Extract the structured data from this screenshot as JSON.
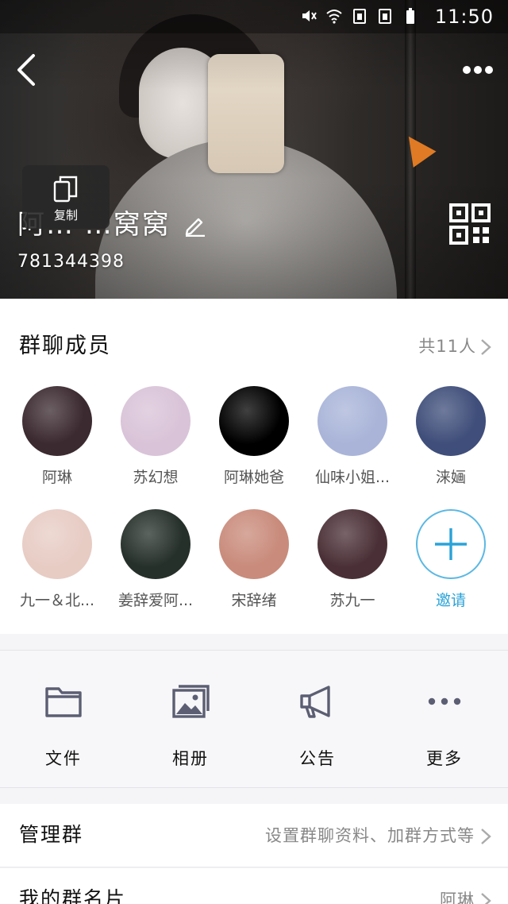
{
  "status_bar": {
    "time": "11:50",
    "icons": [
      "mute-icon",
      "wifi-icon",
      "sim1-icon",
      "sim2-icon",
      "battery-icon"
    ]
  },
  "header": {
    "group_name": "阿… …窝窝",
    "group_id": "781344398",
    "copy_tooltip": "复制"
  },
  "members": {
    "title": "群聊成员",
    "count": "共11人",
    "list": [
      {
        "name": "阿琳",
        "color": "#3b2a30"
      },
      {
        "name": "苏幻想",
        "color": "#d9c3d8"
      },
      {
        "name": "阿琳她爸",
        "color": "#000000"
      },
      {
        "name": "仙味小姐...",
        "color": "#a9b4d8"
      },
      {
        "name": "涞婳",
        "color": "#3f4e7a"
      },
      {
        "name": "九一＆北...",
        "color": "#e7ccc4"
      },
      {
        "name": "姜辞爱阿...",
        "color": "#26302a"
      },
      {
        "name": "宋辞绪",
        "color": "#c98b7b"
      },
      {
        "name": "苏九一",
        "color": "#4a3036"
      }
    ],
    "invite_label": "邀请"
  },
  "functions": [
    {
      "label": "文件",
      "icon": "folder-icon"
    },
    {
      "label": "相册",
      "icon": "album-icon"
    },
    {
      "label": "公告",
      "icon": "megaphone-icon"
    },
    {
      "label": "更多",
      "icon": "more-dots-icon"
    }
  ],
  "rows": {
    "manage": {
      "title": "管理群",
      "value": "设置群聊资料、加群方式等"
    },
    "card": {
      "title": "我的群名片",
      "value": "阿琳"
    }
  },
  "colors": {
    "accent": "#2aa3d8",
    "invite_border": "#5bb8e3",
    "icon_gray": "#5c5f73"
  }
}
